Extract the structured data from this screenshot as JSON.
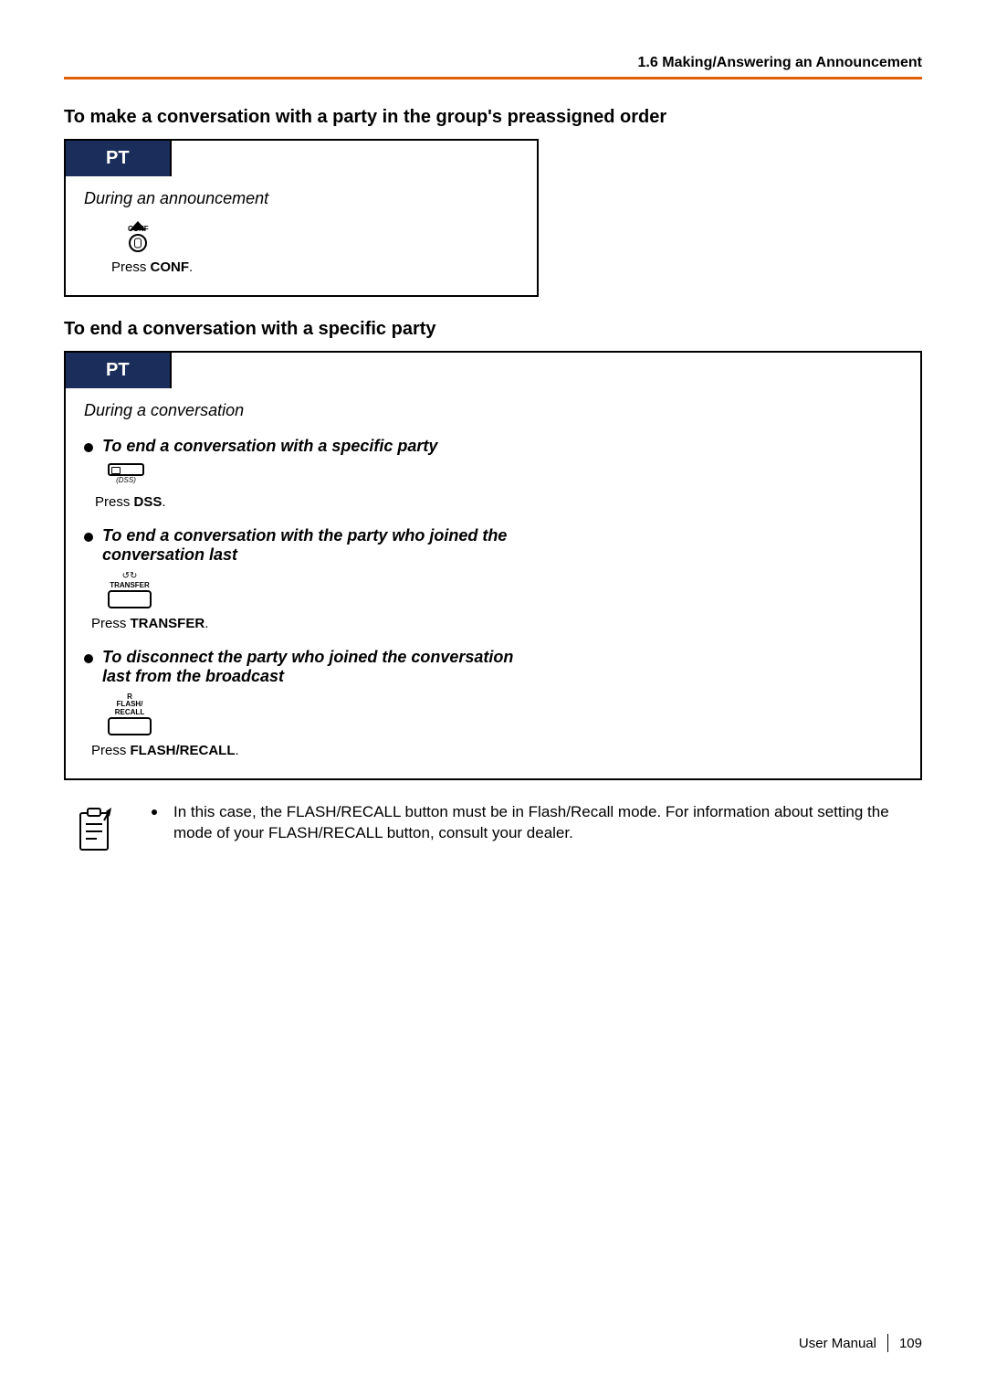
{
  "header": {
    "section_number": "1.6",
    "section_title": "Making/Answering an Announcement"
  },
  "headings": {
    "make_conversation": "To make a conversation with a party in the group's preassigned order",
    "end_conversation": "To end a conversation with a specific party"
  },
  "box1": {
    "pt_label": "PT",
    "context": "During an announcement",
    "conf_icon_label": "CONF",
    "press_prefix": "Press ",
    "press_strong": "CONF",
    "press_suffix": "."
  },
  "box2": {
    "pt_label": "PT",
    "context": "During a conversation",
    "item1": {
      "title": "To end a conversation with a specific party",
      "dss_label": "(DSS)",
      "press_prefix": "Press ",
      "press_strong": "DSS",
      "press_suffix": "."
    },
    "item2": {
      "title": "To end a conversation with the party who joined the conversation last",
      "transfer_label": "TRANSFER",
      "press_prefix": "Press ",
      "press_strong": "TRANSFER",
      "press_suffix": "."
    },
    "item3": {
      "title": "To disconnect the party who joined the conversation last from the broadcast",
      "flash_line1": "R",
      "flash_line2": "FLASH/",
      "flash_line3": "RECALL",
      "press_prefix": "Press ",
      "press_strong": "FLASH/RECALL",
      "press_suffix": "."
    }
  },
  "note": {
    "text": "In this case, the FLASH/RECALL button must be in Flash/Recall mode. For information about setting the mode of your FLASH/RECALL button, consult your dealer."
  },
  "footer": {
    "manual_label": "User Manual",
    "page_number": "109"
  }
}
